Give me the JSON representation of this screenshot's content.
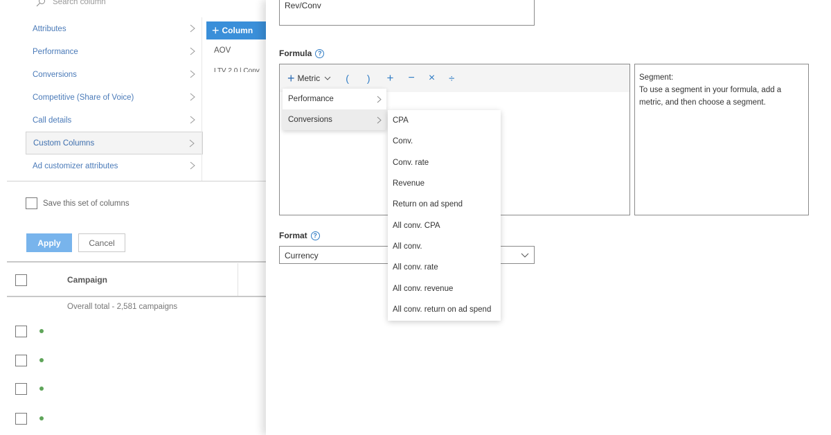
{
  "search": {
    "placeholder": "Search column"
  },
  "categories": [
    {
      "label": "Attributes"
    },
    {
      "label": "Performance"
    },
    {
      "label": "Conversions"
    },
    {
      "label": "Competitive (Share of Voice)"
    },
    {
      "label": "Call details"
    },
    {
      "label": "Custom Columns",
      "selected": true
    },
    {
      "label": "Ad customizer attributes"
    }
  ],
  "add_column": {
    "label": "Column"
  },
  "custom_columns": [
    "AOV",
    "LTV 2.0 | Conv"
  ],
  "save_set": {
    "label": "Save this set of columns"
  },
  "buttons": {
    "apply": "Apply",
    "cancel": "Cancel"
  },
  "table": {
    "header": "Campaign",
    "overall_total": "Overall total - 2,581 campaigns"
  },
  "editor": {
    "name_value": "Rev/Conv",
    "formula_label": "Formula",
    "metric_label": "Metric",
    "operators": [
      "(",
      ")",
      "+",
      "−",
      "×",
      "÷"
    ],
    "format_label": "Format",
    "format_value": "Currency",
    "segment": {
      "title": "Segment:",
      "text": "To use a segment in your formula, add a metric, and then choose a segment."
    }
  },
  "metric_menu": {
    "categories": [
      "Performance",
      "Conversions"
    ],
    "hovered": "Conversions",
    "conversions_items": [
      "CPA",
      "Conv.",
      "Conv. rate",
      "Revenue",
      "Return on ad spend",
      "All conv. CPA",
      "All conv.",
      "All conv. rate",
      "All conv. revenue",
      "All conv. return on ad spend"
    ]
  },
  "colors": {
    "accent": "#3a8fd9",
    "apply_disabled": "#78b4ec",
    "link": "#4a7ab8",
    "status_green": "#5fa55a"
  },
  "icons": [
    "search-icon",
    "chevron-right-icon",
    "plus-icon",
    "chevron-down-icon",
    "help-icon",
    "status-dot-icon"
  ]
}
